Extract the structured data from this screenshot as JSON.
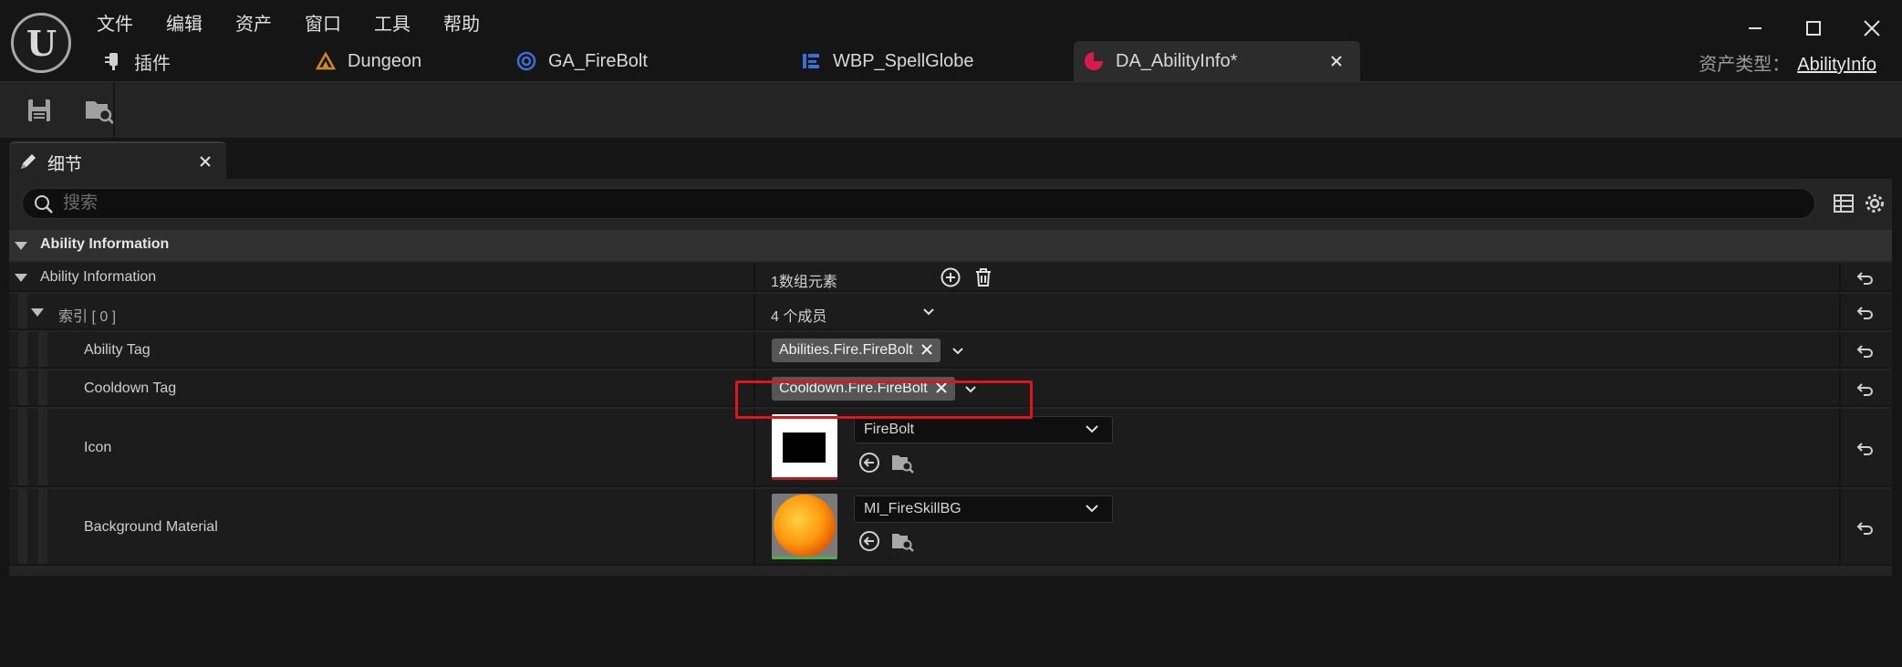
{
  "menu": [
    "文件",
    "编辑",
    "资产",
    "窗口",
    "工具",
    "帮助"
  ],
  "tabs": [
    {
      "label": "插件",
      "icon": "plugin-icon"
    },
    {
      "label": "Dungeon",
      "icon": "level-icon"
    },
    {
      "label": "GA_FireBolt",
      "icon": "blueprint-icon"
    },
    {
      "label": "WBP_SpellGlobe",
      "icon": "widget-blueprint-icon"
    },
    {
      "label": "DA_AbilityInfo*",
      "icon": "data-asset-icon",
      "active": true
    }
  ],
  "asset_type": {
    "label": "资产类型：",
    "value": "AbilityInfo"
  },
  "toolbar": {
    "save_icon": "save-icon",
    "browse_icon": "browse-to-asset-icon"
  },
  "details": {
    "tab_label": "细节",
    "search_placeholder": "搜索",
    "category": "Ability Information",
    "array": {
      "label": "Ability Information",
      "value": "1数组元素"
    },
    "index": {
      "label": "索引 [ 0 ]",
      "value": "4 个成员"
    },
    "fields": {
      "ability_tag": {
        "label": "Ability Tag",
        "value": "Abilities.Fire.FireBolt"
      },
      "cooldown_tag": {
        "label": "Cooldown Tag",
        "value": "Cooldown.Fire.FireBolt"
      },
      "icon": {
        "label": "Icon",
        "value": "FireBolt"
      },
      "background_material": {
        "label": "Background Material",
        "value": "MI_FireSkillBG"
      }
    }
  },
  "colors": {
    "highlight": "#e0141b",
    "active_tab_icon": "#d81b4a",
    "blueprint_icon": "#3a6fd8",
    "level_icon": "#d08a1e"
  }
}
